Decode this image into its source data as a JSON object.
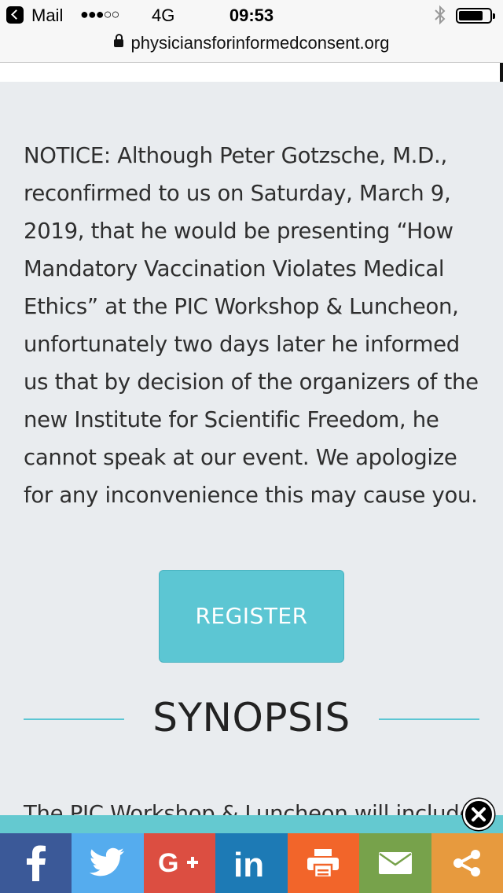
{
  "status_bar": {
    "back_app": "Mail",
    "signal": "●●●○○",
    "network": "4G",
    "time": "09:53"
  },
  "url_bar": {
    "domain": "physiciansforinformedconsent.org"
  },
  "main": {
    "notice": "NOTICE: Although Peter Gotzsche, M.D., reconfirmed to us on Saturday, March 9, 2019, that he would be presenting “How Mandatory Vaccination Violates Medical Ethics” at the PIC Workshop & Luncheon, unfortunately two days later he informed us that by decision of the organizers of the new Institute for Scientific Freedom, he cannot speak at our event. We apologize for any inconvenience this may cause you.",
    "register_label": "REGISTER",
    "synopsis_title": "SYNOPSIS",
    "synopsis_teaser": "The PIC Workshop & Luncheon will include"
  },
  "share_bar": {
    "items": [
      {
        "icon": "facebook-icon",
        "color": "#3b5998"
      },
      {
        "icon": "twitter-icon",
        "color": "#55acee"
      },
      {
        "icon": "google-plus-icon",
        "color": "#dc4e41"
      },
      {
        "icon": "linkedin-icon",
        "color": "#1d7ab5"
      },
      {
        "icon": "print-icon",
        "color": "#f2652a"
      },
      {
        "icon": "email-icon",
        "color": "#77a24b"
      },
      {
        "icon": "share-icon",
        "color": "#e79a3e"
      }
    ],
    "top_strip_color": "#64c9d0"
  },
  "colors": {
    "accent": "#5cc6d3",
    "page_background": "#e9ecef"
  }
}
